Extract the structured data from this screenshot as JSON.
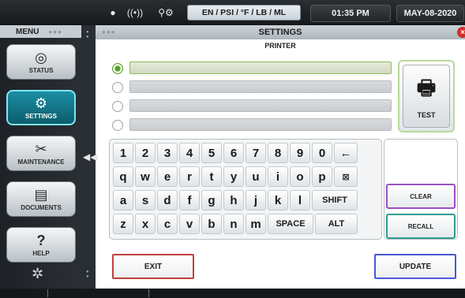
{
  "topbar": {
    "icons": [
      "tank-icon",
      "wireless-icon",
      "gas-meter-icon"
    ],
    "units": "EN / PSI / °F / LB / ML",
    "time": "01:35 PM",
    "date": "MAY-08-2020"
  },
  "menu": {
    "title": "MENU",
    "items": [
      {
        "label": "STATUS",
        "icon": "gauge-icon"
      },
      {
        "label": "SETTINGS",
        "icon": "gear-icon",
        "active": true
      },
      {
        "label": "MAINTENANCE",
        "icon": "tools-icon"
      },
      {
        "label": "DOCUMENTS",
        "icon": "document-icon"
      },
      {
        "label": "HELP",
        "icon": "help-icon"
      }
    ]
  },
  "window": {
    "title": "SETTINGS",
    "subtitle": "PRINTER"
  },
  "printer": {
    "fields": [
      "",
      "",
      "",
      ""
    ],
    "selected_index": 0,
    "test_label": "TEST"
  },
  "keyboard": {
    "row1": [
      "1",
      "2",
      "3",
      "4",
      "5",
      "6",
      "7",
      "8",
      "9",
      "0",
      "←"
    ],
    "row2": [
      "q",
      "w",
      "e",
      "r",
      "t",
      "y",
      "u",
      "i",
      "o",
      "p",
      "⊠"
    ],
    "row3": [
      "a",
      "s",
      "d",
      "f",
      "g",
      "h",
      "j",
      "k",
      "l",
      "SHIFT"
    ],
    "row4": [
      "z",
      "x",
      "c",
      "v",
      "b",
      "n",
      "m",
      "SPACE",
      "ALT"
    ]
  },
  "side": {
    "clear_label": "CLEAR",
    "recall_label": "RECALL"
  },
  "actions": {
    "exit_label": "EXIT",
    "update_label": "UPDATE"
  },
  "colors": {
    "active_menu": "#1b8fa3",
    "selected_field": "#8cc152",
    "clear_border": "#9b4fc4",
    "recall_border": "#2f9c90",
    "exit_border": "#c0413e",
    "update_border": "#4b57d6"
  }
}
